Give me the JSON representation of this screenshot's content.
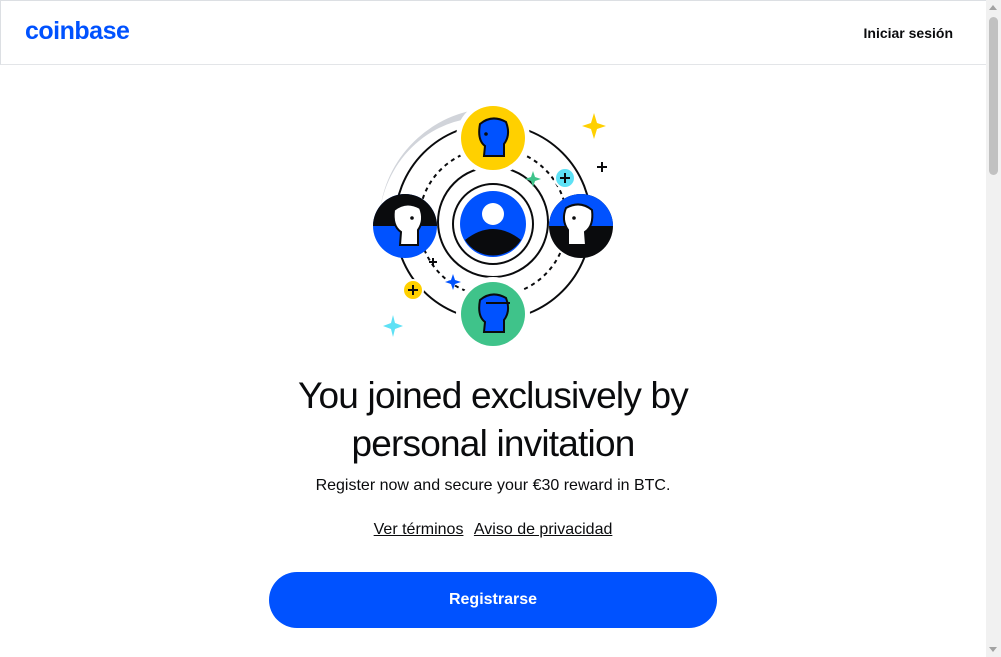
{
  "header": {
    "logo": "coinbase",
    "signin_label": "Iniciar sesión"
  },
  "illustration": {
    "icon": "referral-network-illustration"
  },
  "main": {
    "headline_line1": "You joined exclusively by",
    "headline_line2": "personal invitation",
    "subtext": "Register now and secure your €30 reward in BTC.",
    "terms_link": "Ver términos",
    "privacy_link": "Aviso de privacidad",
    "register_button": "Registrarse"
  },
  "colors": {
    "brand_blue": "#0052ff",
    "yellow": "#ffd000",
    "green": "#3fc38a",
    "cyan": "#5ee1f5"
  }
}
